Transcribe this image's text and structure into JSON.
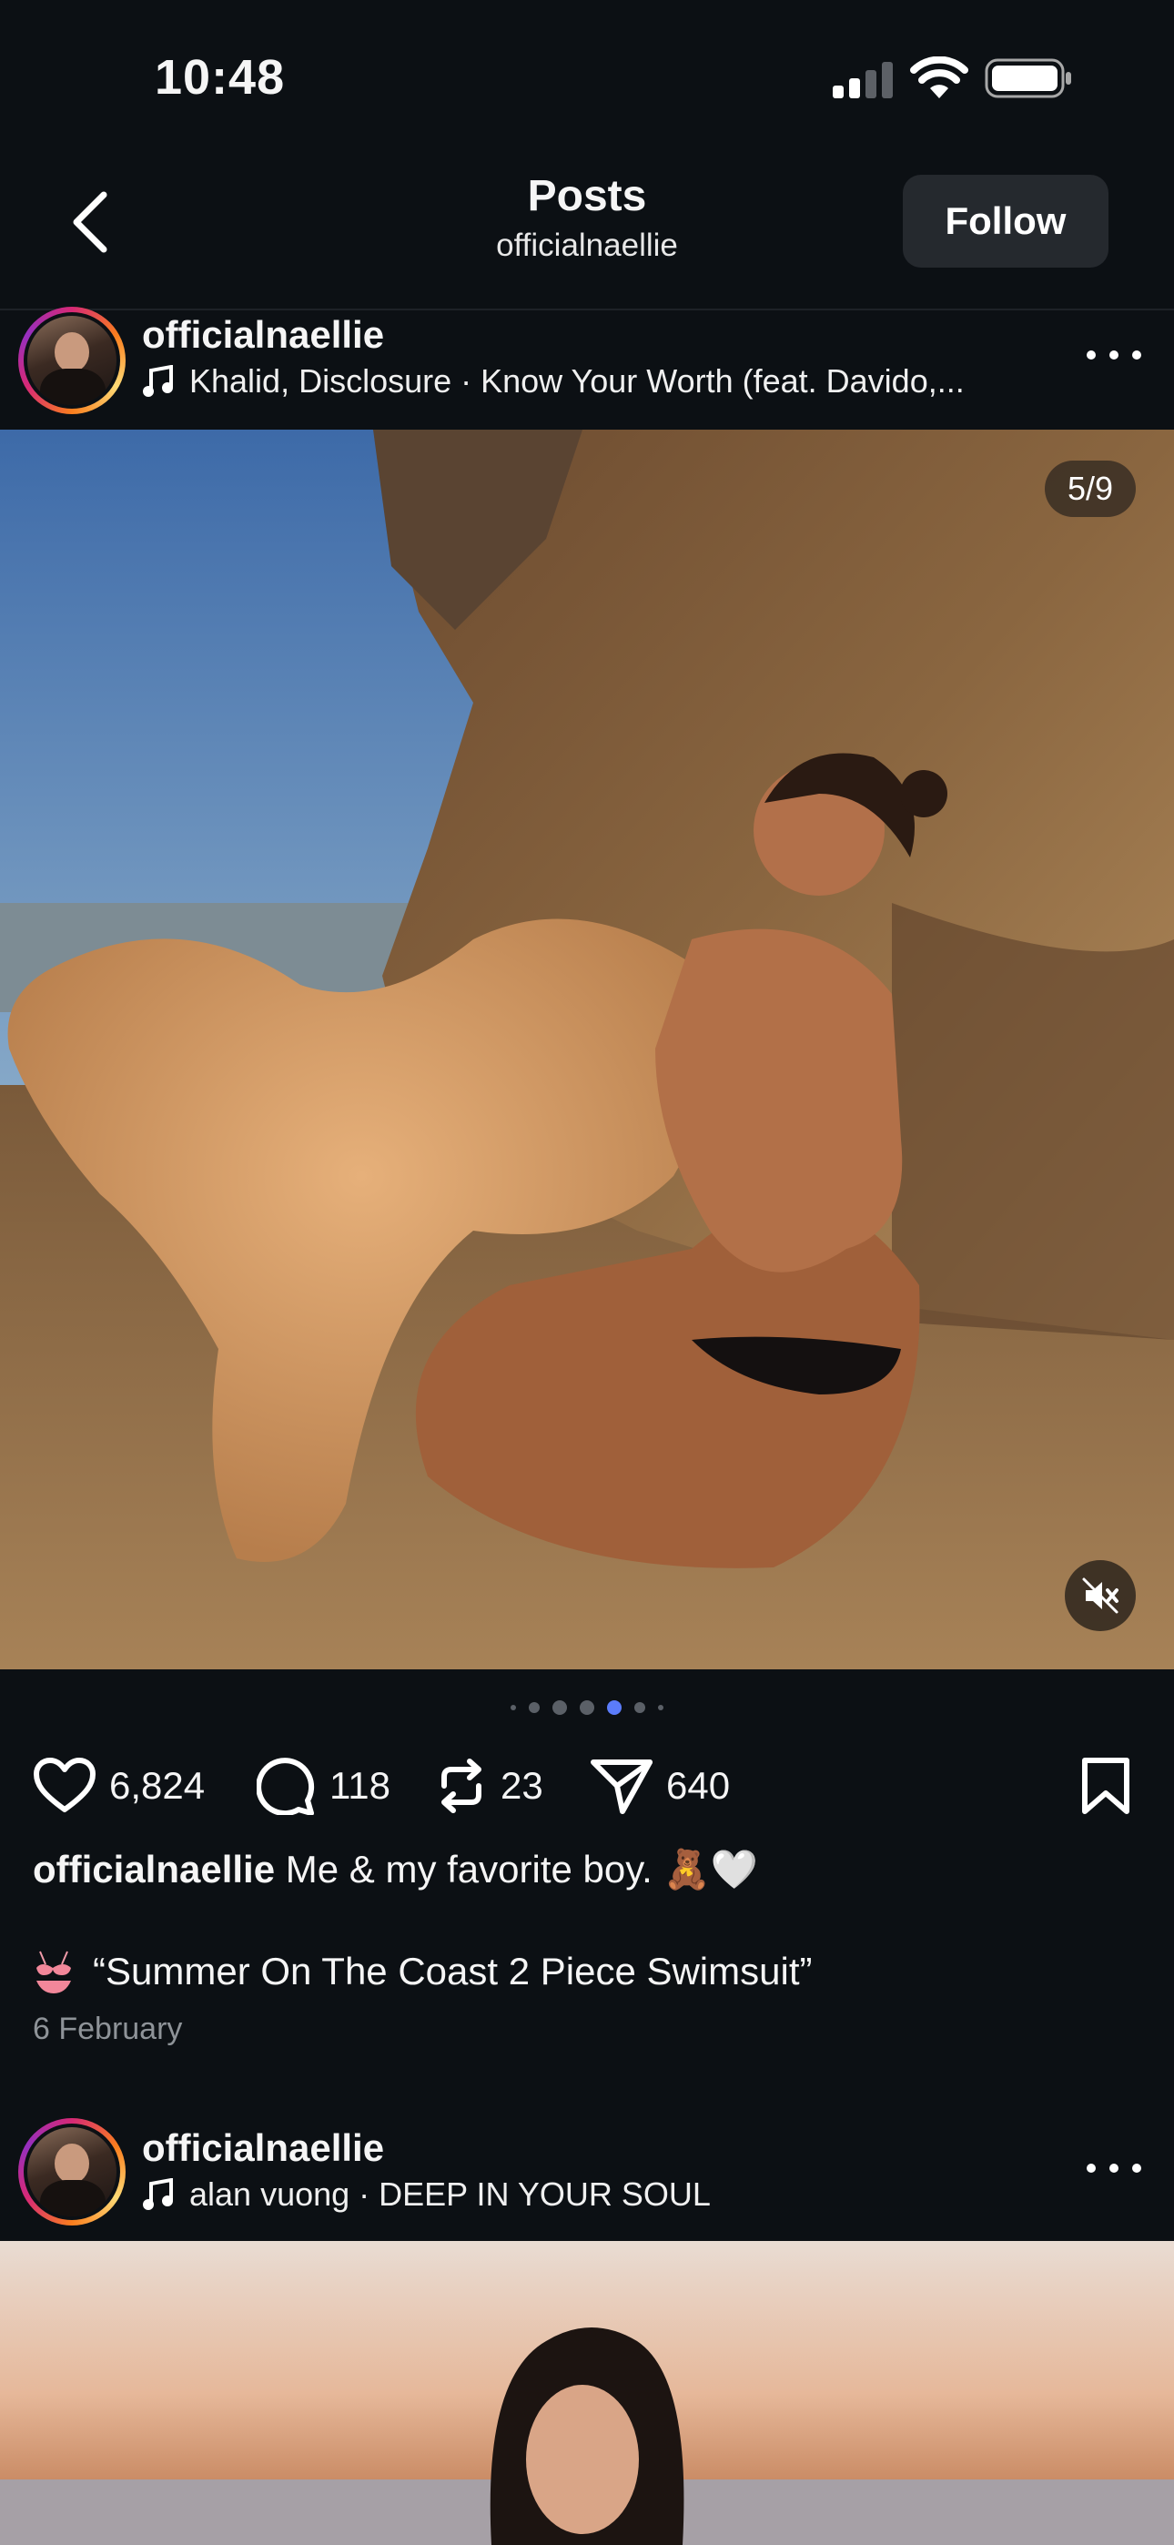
{
  "status_bar": {
    "time": "10:48"
  },
  "nav": {
    "title": "Posts",
    "subtitle": "officialnaellie",
    "follow_label": "Follow"
  },
  "posts": [
    {
      "username": "officialnaellie",
      "music": "Khalid, Disclosure · Know Your Worth (feat. Davido,...",
      "media_counter": "5/9",
      "carousel": {
        "total_dots": 7,
        "active_dot": 4
      },
      "likes": "6,824",
      "comments": "118",
      "reposts": "23",
      "shares": "640",
      "caption_user": "officialnaellie",
      "caption_text": "Me & my favorite boy. 🧸🤍",
      "product_tag": "“Summer On The Coast 2 Piece Swimsuit”",
      "date": "6 February"
    },
    {
      "username": "officialnaellie",
      "music": "alan vuong · DEEP IN YOUR SOUL"
    }
  ],
  "icons": {
    "back": "chevron-left-icon",
    "music": "music-note-icon",
    "more": "more-dots-icon",
    "mute": "speaker-muted-icon",
    "like": "heart-icon",
    "comment": "comment-bubble-icon",
    "repost": "repost-icon",
    "share": "send-icon",
    "save": "bookmark-icon",
    "product": "bikini-icon"
  },
  "colors": {
    "background": "#0c1014",
    "button_bg": "#25292e",
    "active_dot": "#5b7cfa",
    "muted_text": "#8e9398"
  }
}
